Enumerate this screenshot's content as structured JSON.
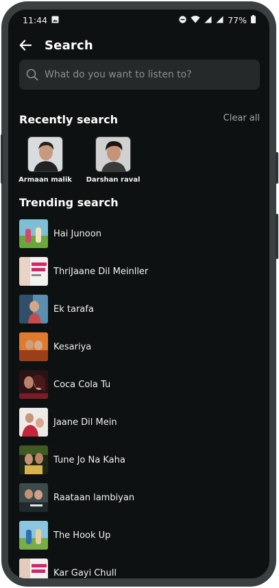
{
  "status_bar": {
    "time": "11:44",
    "battery": "77%"
  },
  "header": {
    "title": "Search"
  },
  "search": {
    "placeholder": "What do you want to listen to?"
  },
  "recent": {
    "title": "Recently search",
    "clear_label": "Clear all",
    "items": [
      {
        "name": "Armaan malik"
      },
      {
        "name": "Darshan raval"
      }
    ]
  },
  "trending": {
    "title": "Trending search",
    "items": [
      {
        "title": "Hai Junoon"
      },
      {
        "title": "ThriJaane Dil Meinller"
      },
      {
        "title": "Ek tarafa"
      },
      {
        "title": "Kesariya"
      },
      {
        "title": "Coca Cola Tu"
      },
      {
        "title": "Jaane Dil Mein"
      },
      {
        "title": "Tune Jo Na Kaha"
      },
      {
        "title": "Raataan lambiyan"
      },
      {
        "title": "The Hook Up"
      },
      {
        "title": "Kar Gayi Chull"
      }
    ]
  },
  "colors": {
    "background": "#0e1111",
    "search_field": "#25292a",
    "frame": "#3a3f41",
    "muted_text": "#a4a8a9"
  }
}
